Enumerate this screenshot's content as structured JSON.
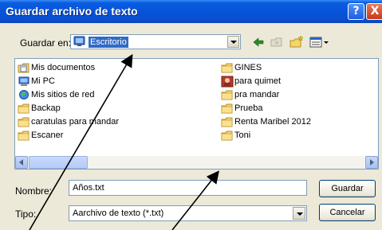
{
  "window": {
    "title": "Guardar archivo de texto",
    "help_label": "?",
    "close_label": "X"
  },
  "save_in": {
    "label": "Guardar en:",
    "value": "Escritorio"
  },
  "files_left": [
    {
      "name": "Mis documentos",
      "icon": "my-documents-icon"
    },
    {
      "name": "Mi PC",
      "icon": "my-computer-icon"
    },
    {
      "name": "Mis sitios de red",
      "icon": "network-places-icon"
    },
    {
      "name": "Backap",
      "icon": "folder-icon"
    },
    {
      "name": "caratulas para mandar",
      "icon": "folder-icon"
    },
    {
      "name": "Escaner",
      "icon": "folder-icon"
    }
  ],
  "files_right": [
    {
      "name": "GINES",
      "icon": "folder-icon"
    },
    {
      "name": "para quimet",
      "icon": "image-file-icon"
    },
    {
      "name": "pra mandar",
      "icon": "folder-icon"
    },
    {
      "name": "Prueba",
      "icon": "folder-icon"
    },
    {
      "name": "Renta Maribel 2012",
      "icon": "folder-icon"
    },
    {
      "name": "Toni",
      "icon": "folder-icon"
    }
  ],
  "filename": {
    "label": "Nombre:",
    "value": "Años.txt"
  },
  "filetype": {
    "label": "Tipo:",
    "value": "Aarchivo de texto (*.txt)"
  },
  "buttons": {
    "save": "Guardar",
    "cancel": "Cancelar"
  },
  "colors": {
    "titlebar": "#0653d8",
    "selection": "#316ac5",
    "dialog_bg": "#ece9d8"
  }
}
